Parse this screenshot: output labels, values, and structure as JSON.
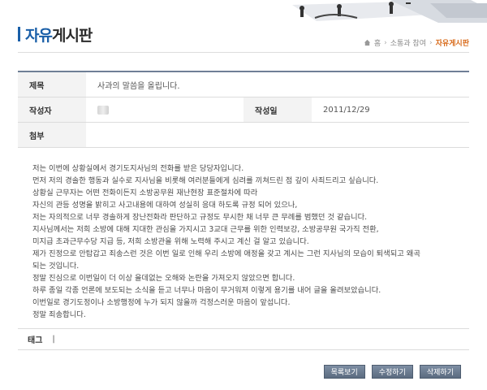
{
  "header": {
    "title_blue": "자유",
    "title_rest": "게시판"
  },
  "breadcrumb": {
    "home_label": "홈",
    "parent": "소통과 참여",
    "current": "자유게시판"
  },
  "post": {
    "subject_label": "제목",
    "subject_value": "사과의 말씀을 올립니다.",
    "author_label": "작성자",
    "date_label": "작성일",
    "date_value": "2011/12/29",
    "attachment_label": "첨부"
  },
  "body_lines": [
    "저는 이번에 상황실에서 경기도지사님의 전화를 받은 당당자입니다.",
    "먼저 저의 경솔한 행동과 실수로 지사님을 비롯해 여러분들에게 심려를 끼쳐드린 점 깊이 사죄드리고 싶습니다.",
    "상황실 근무자는 어떤 전화이든지 소방공무원 재난현장 표준절차에 따라",
    "자신의 관등 성명을 밝히고 사고내용에 대하여 성실히 응대 하도록 규정 되어 있으나,",
    "저는 자의적으로 너무 경솔하게 장난전화라 판단하고 규정도 무시한 채 너무 큰 무례를 범했던 것 같습니다.",
    "지사님께서는 저희 소방에 대해 지대한 관심을 가지시고 3교대 근무를 위한 인력보강, 소방공무원 국가직 전환,",
    "미지급 초과근무수당 지급 등, 저희 소방관을 위해 노력해 주시고 계신 걸 알고 있습니다.",
    "제가 진정으로 안탑갑고 죄송스런 것은 이번 일로 인해 우리 소방에 애정을 갖고 계시는 그런 지사님의 모습이 퇴색되고 왜곡",
    "되는 것입니다.",
    "정말 진심으로 이번일이 더 이상 을데없는 오해와 논란을 가져오지 않았으면 합니다.",
    "하루 종일 각종 언론에 보도되는 소식을 듣고 너무나 마음이 무거워져 이렇게 용기를 내어 글을 올려보았습니다.",
    "이번일로 경기도정이나 소방행정에 누가 되지 않을까 걱정스러운 마음이 앞섭니다.",
    "정말 죄송합니다."
  ],
  "tags": {
    "label": "태그",
    "separator": "|"
  },
  "buttons": {
    "list": "목록보기",
    "edit": "수정하기",
    "delete": "삭제하기"
  },
  "colors": {
    "accent": "#1a5fa8",
    "breadcrumb_current": "#d86a1a",
    "button": "#5b6b80"
  }
}
